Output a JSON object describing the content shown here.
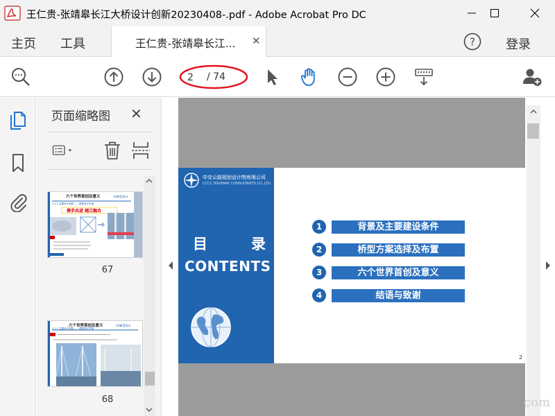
{
  "window": {
    "title": "王仁贵-张靖皋长江大桥设计创新20230408-.pdf - Adobe Acrobat Pro DC"
  },
  "menu": {
    "home": "主页",
    "tools": "工具",
    "doc_tab": "王仁贵-张靖皋长江...",
    "login": "登录"
  },
  "toolbar": {
    "current_page": "2",
    "total_pages": "/ 74",
    "highlight_color": "#e0141e"
  },
  "thumbnails": {
    "title": "页面缩略图",
    "pages": [
      {
        "number": "67",
        "heading": "六个世界首创及意义",
        "tag": "(4)新型设计",
        "subtitle": "2.5.1 主要设计创新 ——新型设计手段",
        "banner": "携手共进 踏江融合"
      },
      {
        "number": "68",
        "heading": "六个世界首创及意义",
        "tag": "(4)新型设计",
        "subtitle": "2.5.1 主要设计创新 ——新型设计手段"
      }
    ]
  },
  "slide": {
    "company_cn": "中交公路规划设计院有限公司",
    "company_en": "CCCC HIGHWAY CONSULTANTS CO.,LTD.",
    "mulu_left": "目",
    "mulu_right": "录",
    "contents": "CONTENTS",
    "toc": [
      {
        "num": "1",
        "label": "背景及主要建设条件"
      },
      {
        "num": "2",
        "label": "桥型方案选择及布置"
      },
      {
        "num": "3",
        "label": "六个世界首创及意义"
      },
      {
        "num": "4",
        "label": "结语与致谢"
      }
    ],
    "page_number": "2",
    "accent": "#2164b0"
  },
  "watermark": "com"
}
